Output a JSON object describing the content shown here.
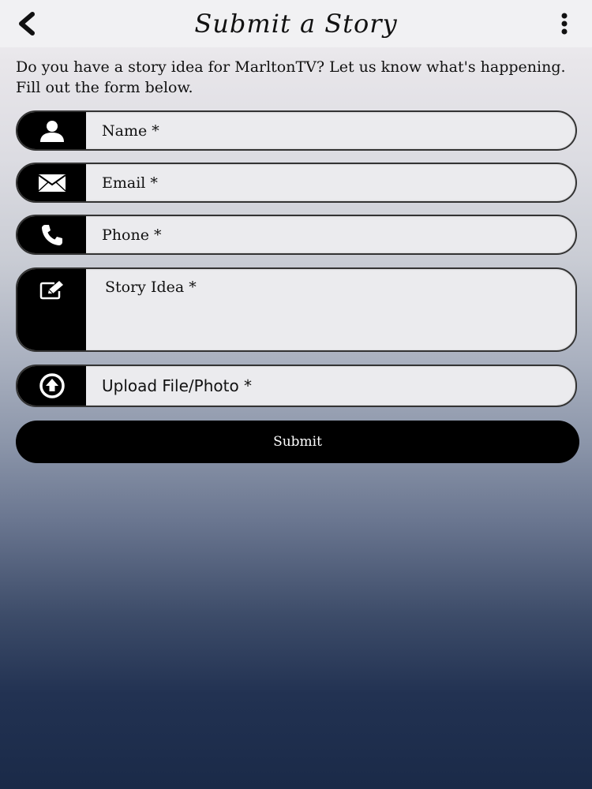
{
  "header": {
    "title": "Submit a Story",
    "back_icon": "chevron-left-icon",
    "menu_icon": "more-vertical-icon"
  },
  "intro_text": "Do you have a story idea for MarltonTV? Let us know what's happening. Fill out the form below.",
  "form": {
    "name_placeholder": "Name *",
    "email_placeholder": "Email *",
    "phone_placeholder": "Phone *",
    "story_placeholder": "Story Idea *",
    "upload_label": "Upload File/Photo *",
    "submit_label": "Submit"
  },
  "colors": {
    "icon_bg": "#000000",
    "field_bg": "#ebebee",
    "header_bg": "#f1f1f3"
  }
}
